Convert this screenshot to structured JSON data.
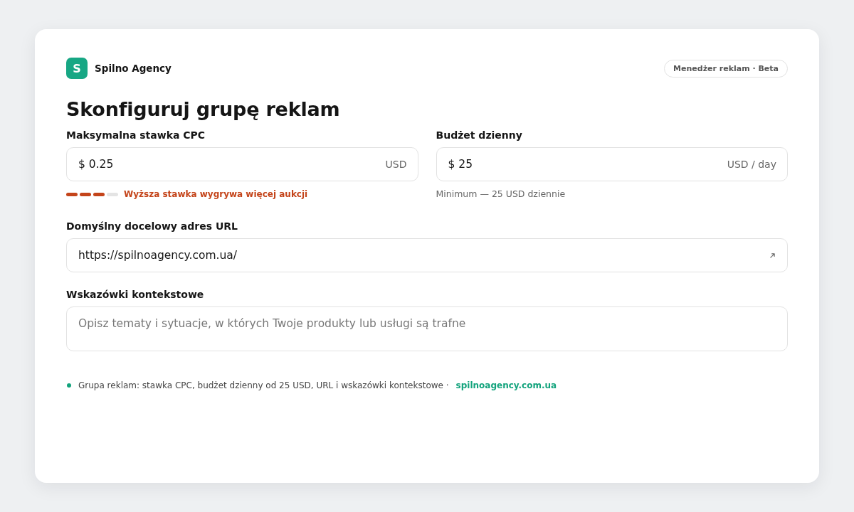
{
  "brand": {
    "logo_letter": "S",
    "name": "Spilno Agency"
  },
  "badge": "Menedżer reklam · Beta",
  "title": "Skonfiguruj grupę reklam",
  "fields": [
    {
      "kind": "amount",
      "label": "Maksymalna stawka CPC",
      "value": "$ 0.25",
      "suffix": "USD",
      "meter": {
        "level": 0.75,
        "text": "Wyższa stawka wygrywa więcej aukcji"
      }
    },
    {
      "kind": "amount",
      "label": "Budżet dzienny",
      "value": "$ 25",
      "suffix": "USD / day",
      "hint": "Minimum — 25 USD dziennie"
    },
    {
      "kind": "url",
      "label": "Domyślny docelowy adres URL",
      "value": "https://spilnoagency.com.ua/"
    },
    {
      "kind": "textarea",
      "label": "Wskazówki kontekstowe",
      "placeholder": "Opisz tematy i sytuacje, w których Twoje produkty lub usługi są trafne"
    }
  ],
  "footer": {
    "text": "Grupa reklam: stawka CPC, budżet dzienny od 25 USD, URL i wskazówki kontekstowe ·",
    "link": "spilnoagency.com.ua"
  }
}
